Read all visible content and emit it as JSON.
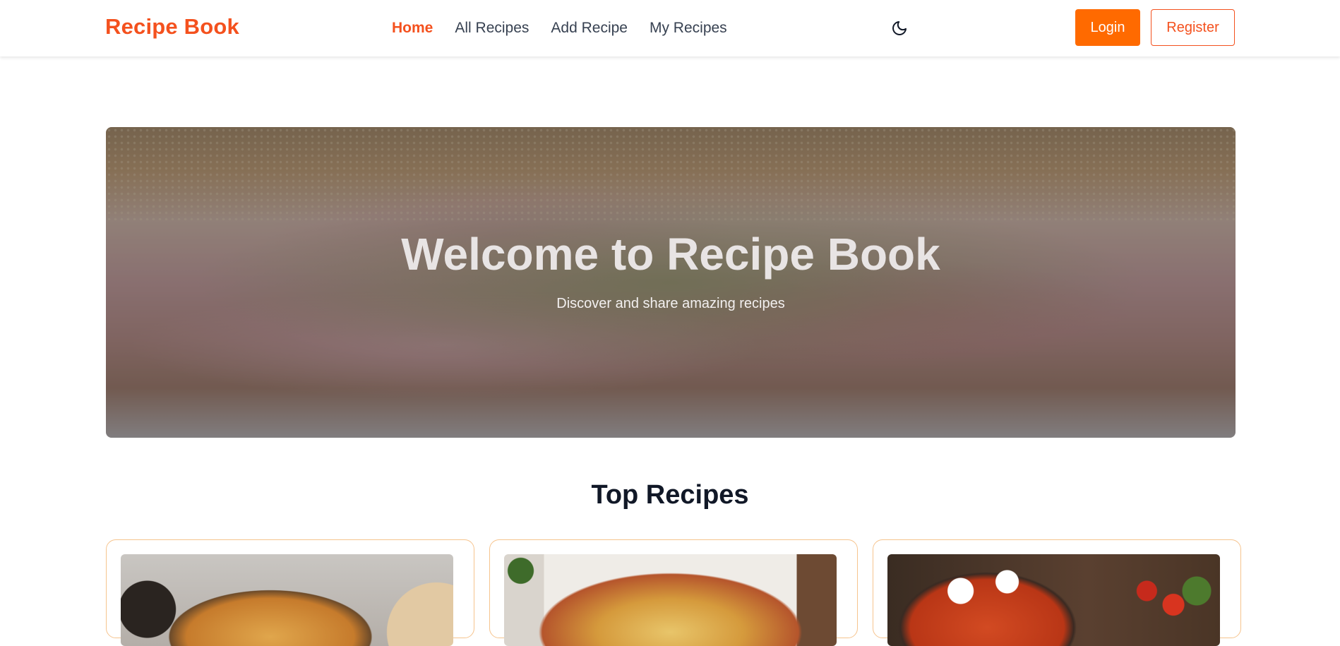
{
  "brand": "Recipe Book",
  "nav": {
    "links": [
      {
        "label": "Home",
        "active": true
      },
      {
        "label": "All Recipes",
        "active": false
      },
      {
        "label": "Add Recipe",
        "active": false
      },
      {
        "label": "My Recipes",
        "active": false
      }
    ],
    "theme_toggle_icon": "moon-icon"
  },
  "auth": {
    "login_label": "Login",
    "register_label": "Register"
  },
  "hero": {
    "title": "Welcome to Recipe Book",
    "subtitle": "Discover and share amazing recipes"
  },
  "top_recipes": {
    "title": "Top Recipes",
    "cards": [
      {
        "image": "pasta-dish-image"
      },
      {
        "image": "lasagna-dish-image"
      },
      {
        "image": "shakshuka-dish-image"
      }
    ]
  },
  "colors": {
    "accent": "#f4511e",
    "login_bg": "#ff6a00",
    "card_border": "#f6c48e"
  }
}
